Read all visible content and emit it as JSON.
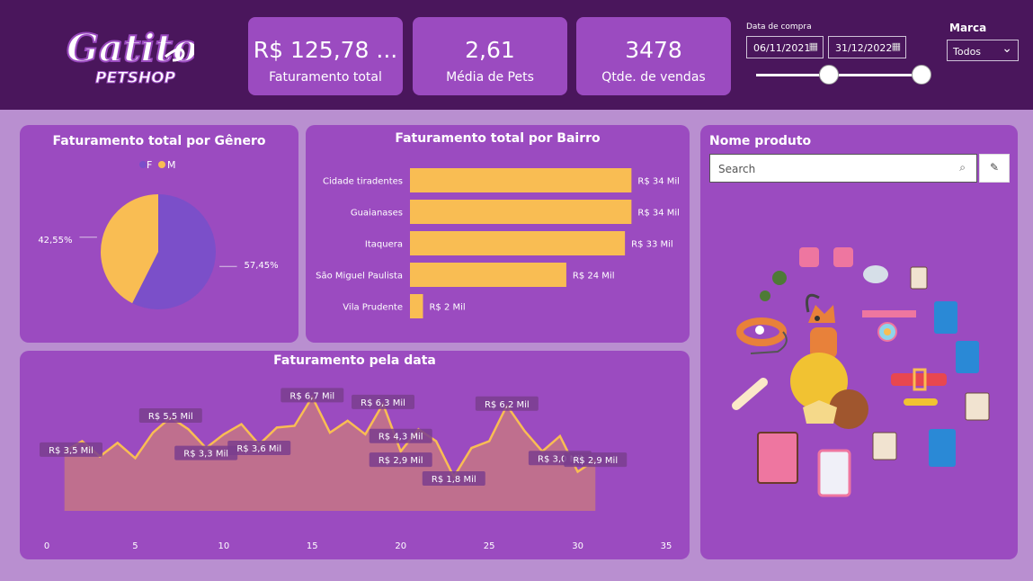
{
  "header": {
    "logo_text_1": "Gatito",
    "logo_text_2": "PETSHOP"
  },
  "kpis": [
    {
      "value": "R$ 125,78 ...",
      "label": "Faturamento total"
    },
    {
      "value": "2,61",
      "label": "Média de Pets"
    },
    {
      "value": "3478",
      "label": "Qtde. de vendas"
    }
  ],
  "filters": {
    "date_label": "Data de compra",
    "date_start": "06/11/2021",
    "date_end": "31/12/2022",
    "brand_label": "Marca",
    "brand_value": "Todos"
  },
  "gender_panel": {
    "title": "Faturamento total por Gênero",
    "legend": [
      "F",
      "M"
    ]
  },
  "bairro_panel": {
    "title": "Faturamento total por Bairro"
  },
  "date_panel": {
    "title": "Faturamento pela data"
  },
  "product_panel": {
    "title": "Nome produto",
    "search_placeholder": "Search"
  },
  "colors": {
    "F": "#7b4fc9",
    "M": "#f9bd53",
    "bar": "#f9bd53",
    "line": "#f9bd53",
    "area": "#c57585",
    "panel": "#9b4bc0",
    "topbar": "#4a165c"
  },
  "chart_data": [
    {
      "type": "pie",
      "title": "Faturamento total por Gênero",
      "labels": [
        "F",
        "M"
      ],
      "values": [
        57.45,
        42.55
      ],
      "data_labels": [
        "57,45%",
        "42,55%"
      ],
      "legend": "top"
    },
    {
      "type": "bar",
      "orientation": "horizontal",
      "title": "Faturamento total por Bairro",
      "categories": [
        "Cidade tiradentes",
        "Guaianases",
        "Itaquera",
        "São Miguel Paulista",
        "Vila Prudente"
      ],
      "values": [
        34,
        34,
        33,
        24,
        2
      ],
      "data_labels": [
        "R$ 34 Mil",
        "R$ 34 Mil",
        "R$ 33 Mil",
        "R$ 24 Mil",
        "R$ 2 Mil"
      ],
      "unit": "R$ Mil"
    },
    {
      "type": "area",
      "title": "Faturamento pela data",
      "x": [
        1,
        2,
        3,
        4,
        5,
        6,
        7,
        8,
        9,
        10,
        11,
        12,
        13,
        14,
        15,
        16,
        17,
        18,
        19,
        20,
        21,
        22,
        23,
        24,
        25,
        26,
        27,
        28,
        29,
        30,
        31
      ],
      "values": [
        3.5,
        4.1,
        3.2,
        4.0,
        3.1,
        4.6,
        5.5,
        4.8,
        3.7,
        4.5,
        5.1,
        3.9,
        4.9,
        5.0,
        6.7,
        4.6,
        5.3,
        4.5,
        6.3,
        3.5,
        4.8,
        4.1,
        2.0,
        3.7,
        4.1,
        6.2,
        4.7,
        3.5,
        4.4,
        2.3,
        3.0
      ],
      "annotations": [
        {
          "x": 1,
          "label": "R$ 3,5 Mil"
        },
        {
          "x": 7,
          "label": "R$ 5,5 Mil"
        },
        {
          "x": 9,
          "label": "R$ 3,3 Mil"
        },
        {
          "x": 12,
          "label": "R$ 3,6 Mil"
        },
        {
          "x": 15,
          "label": "R$ 6,7 Mil"
        },
        {
          "x": 19,
          "label": "R$ 6,3 Mil"
        },
        {
          "x": 20,
          "label": "R$ 4,3 Mil"
        },
        {
          "x": 20,
          "label": "R$ 2,9 Mil"
        },
        {
          "x": 23,
          "label": "R$ 1,8 Mil"
        },
        {
          "x": 26,
          "label": "R$ 6,2 Mil"
        },
        {
          "x": 29,
          "label": "R$ 3,0 Mil"
        },
        {
          "x": 31,
          "label": "R$ 2,9 Mil"
        }
      ],
      "xlim": [
        0,
        35
      ],
      "xticks": [
        0,
        5,
        10,
        15,
        20,
        25,
        30,
        35
      ],
      "unit": "R$ Mil"
    }
  ]
}
